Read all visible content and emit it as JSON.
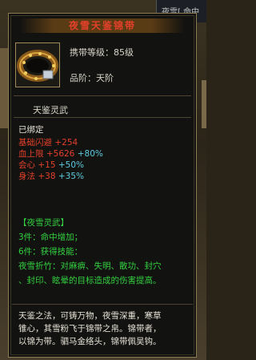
{
  "background": {
    "top_right_text": "夜雪[  命中"
  },
  "item": {
    "name": "夜雪天鉴锦带",
    "level_label": "携带等级：85级",
    "quality_label": "品阶：天阶",
    "skill_title": "天鉴灵武",
    "bound": "已绑定",
    "stats": [
      {
        "name": "基础闪避",
        "base": "+254",
        "bonus": ""
      },
      {
        "name": "血上限",
        "base": "+5626",
        "bonus": "+80%"
      },
      {
        "name": "会心",
        "base": "+15",
        "bonus": "+50%"
      },
      {
        "name": "身法",
        "base": "+38",
        "bonus": "+35%"
      }
    ],
    "set_name": "【夜雪灵武】",
    "set_3": "3件：命中增加；",
    "set_6": "6件：获得技能：",
    "skill_line_1": "夜雪折竹：对麻痹、失明、散功、封穴",
    "skill_line_2": "、封印、眩晕的目标造成的伤害提高。",
    "description_lines": [
      "天鉴之法，可铸万物，夜雪深重，寒草",
      "锥心，其雪粉飞于锦带之帛。锦带者，",
      "以锦为带。驷马金络头，锦带佩吴钩。"
    ]
  },
  "colors": {
    "title": "#e4402a",
    "bound": "#e6e2d6",
    "stat": "#e4402a",
    "set": "#33d040",
    "bonus": "#5ecbe0"
  }
}
